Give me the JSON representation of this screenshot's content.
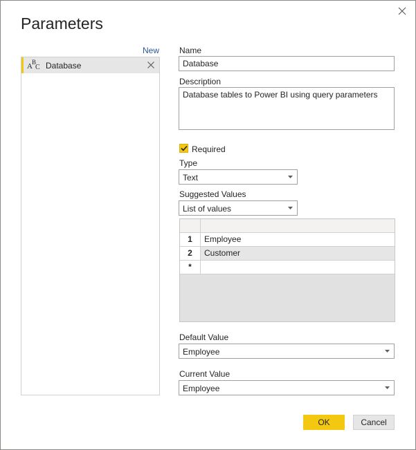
{
  "dialog": {
    "title": "Parameters",
    "new_link": "New"
  },
  "parameters": [
    {
      "type_icon": "abc-icon",
      "name": "Database"
    }
  ],
  "form": {
    "name_label": "Name",
    "name_value": "Database",
    "description_label": "Description",
    "description_value": "Database tables to Power BI using query parameters",
    "required_label": "Required",
    "required_checked": true,
    "type_label": "Type",
    "type_value": "Text",
    "suggested_label": "Suggested Values",
    "suggested_value": "List of values",
    "values_table": {
      "rows": [
        {
          "index": "1",
          "value": "Employee"
        },
        {
          "index": "2",
          "value": "Customer"
        },
        {
          "index": "*",
          "value": ""
        }
      ]
    },
    "default_label": "Default Value",
    "default_value": "Employee",
    "current_label": "Current Value",
    "current_value": "Employee"
  },
  "buttons": {
    "ok": "OK",
    "cancel": "Cancel"
  },
  "colors": {
    "accent": "#f2c811",
    "link": "#2b579a"
  }
}
